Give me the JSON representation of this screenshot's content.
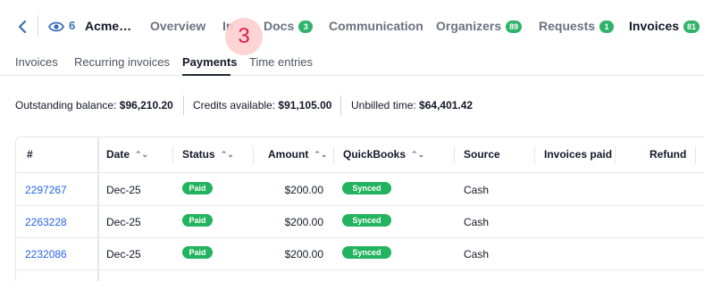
{
  "nav": {
    "eye_count": "6",
    "client": "Acme…",
    "tabs": [
      {
        "label": "Overview",
        "badge": ""
      },
      {
        "label": "In",
        "badge": ""
      },
      {
        "label": "Docs",
        "badge": "3"
      },
      {
        "label": "Communication",
        "badge": ""
      },
      {
        "label": "Organizers",
        "badge": "89"
      },
      {
        "label": "Requests",
        "badge": "1"
      },
      {
        "label": "Invoices",
        "badge": "81"
      }
    ],
    "step_marker": "3"
  },
  "subtabs": [
    "Invoices",
    "Recurring invoices",
    "Payments",
    "Time entries"
  ],
  "summary": {
    "outstanding_label": "Outstanding balance:",
    "outstanding_value": "$96,210.20",
    "credits_label": "Credits available:",
    "credits_value": "$91,105.00",
    "unbilled_label": "Unbilled time:",
    "unbilled_value": "$64,401.42"
  },
  "table": {
    "headers": [
      "#",
      "Date",
      "Status",
      "Amount",
      "QuickBooks",
      "Source",
      "Invoices paid",
      "Refund"
    ],
    "rows": [
      {
        "id": "2297267",
        "date": "Dec-25",
        "status": "Paid",
        "amount": "$200.00",
        "qb": "Synced",
        "source": "Cash"
      },
      {
        "id": "2263228",
        "date": "Dec-25",
        "status": "Paid",
        "amount": "$200.00",
        "qb": "Synced",
        "source": "Cash"
      },
      {
        "id": "2232086",
        "date": "Dec-25",
        "status": "Paid",
        "amount": "$200.00",
        "qb": "Synced",
        "source": "Cash"
      }
    ]
  },
  "colors": {
    "accent": "#3b6fb6",
    "badge_green": "#2fb36a",
    "link": "#2563eb"
  }
}
